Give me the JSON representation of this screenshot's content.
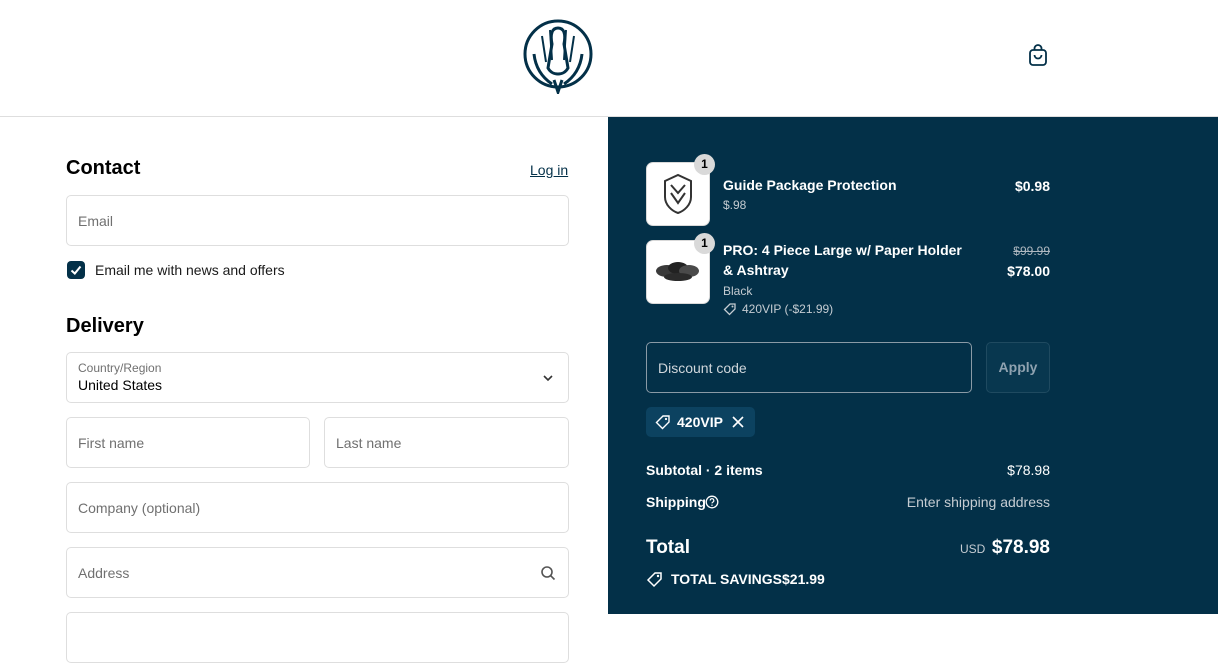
{
  "header": {
    "logo_icon": "bird-logo-icon",
    "cart_icon": "shopping-bag-icon"
  },
  "contact": {
    "title": "Contact",
    "login_label": "Log in",
    "email_placeholder": "Email",
    "newsletter_label": "Email me with news and offers",
    "newsletter_checked": true
  },
  "delivery": {
    "title": "Delivery",
    "country_label": "Country/Region",
    "country_value": "United States",
    "first_name_placeholder": "First name",
    "last_name_placeholder": "Last name",
    "company_placeholder": "Company (optional)",
    "address_placeholder": "Address"
  },
  "summary": {
    "items": [
      {
        "qty": "1",
        "name": "Guide Package Protection",
        "variant": "$.98",
        "price": "$0.98"
      },
      {
        "qty": "1",
        "name": "PRO: 4 Piece Large w/ Paper Holder & Ashtray",
        "variant": "Black",
        "discount": "420VIP (-$21.99)",
        "old_price": "$99.99",
        "price": "$78.00"
      }
    ],
    "discount_placeholder": "Discount code",
    "apply_label": "Apply",
    "applied_code": "420VIP",
    "subtotal_label": "Subtotal · 2 items",
    "subtotal_value": "$78.98",
    "shipping_label": "Shipping",
    "shipping_value": "Enter shipping address",
    "total_label": "Total",
    "currency": "USD",
    "total_value": "$78.98",
    "savings_label": "TOTAL SAVINGS",
    "savings_value": "$21.99"
  },
  "colors": {
    "accent": "#033048",
    "chip": "#0c4260"
  }
}
